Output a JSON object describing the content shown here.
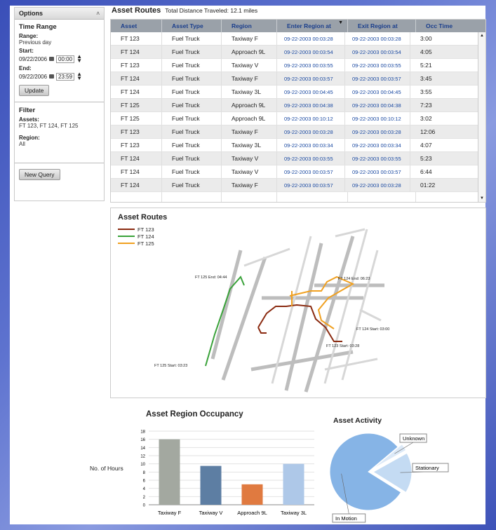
{
  "options": {
    "header": "Options",
    "collapse_icon": "double-chevron-up",
    "time_range_title": "Time Range",
    "range_label": "Range:",
    "range_value": "Previous day",
    "start_label": "Start:",
    "start_date": "09/22/2006",
    "start_time": "00:00",
    "end_label": "End:",
    "end_date": "09/22/2006",
    "end_time": "23:59",
    "update_button": "Update",
    "filter_title": "Filter",
    "assets_label": "Assets:",
    "assets_value": "FT 123, FT 124, FT 125",
    "region_label": "Region:",
    "region_value": "All",
    "new_query_button": "New Query"
  },
  "routes_table": {
    "title": "Asset Routes",
    "subtitle": "Total Distance Traveled: 12.1 miles",
    "columns": [
      "Asset",
      "Asset Type",
      "Region",
      "Enter Region at",
      "Exit Region at",
      "Occ Time"
    ],
    "sort_column": "Enter Region at",
    "rows": [
      [
        "FT 123",
        "Fuel Truck",
        "Taxiway F",
        "09-22-2003 00:03:28",
        "09-22-2003 00:03:28",
        "3:00"
      ],
      [
        "FT 124",
        "Fuel Truck",
        "Approach 9L",
        "09-22-2003 00:03:54",
        "09-22-2003 00:03:54",
        "4:05"
      ],
      [
        "FT 123",
        "Fuel Truck",
        "Taxiway V",
        "09-22-2003 00:03:55",
        "09-22-2003 00:03:55",
        "5:21"
      ],
      [
        "FT 124",
        "Fuel Truck",
        "Taxiway F",
        "09-22-2003 00:03:57",
        "09-22-2003 00:03:57",
        "3:45"
      ],
      [
        "FT 124",
        "Fuel Truck",
        "Taxiway 3L",
        "09-22-2003 00:04:45",
        "09-22-2003 00:04:45",
        "3:55"
      ],
      [
        "FT 125",
        "Fuel Truck",
        "Approach 9L",
        "09-22-2003 00:04:38",
        "09-22-2003 00:04:38",
        "7:23"
      ],
      [
        "FT 125",
        "Fuel Truck",
        "Approach 9L",
        "09-22-2003 00:10:12",
        "09-22-2003 00:10:12",
        "3:02"
      ],
      [
        "FT 123",
        "Fuel Truck",
        "Taxiway F",
        "09-22-2003 00:03:28",
        "09-22-2003 00:03:28",
        "12:06"
      ],
      [
        "FT 123",
        "Fuel Truck",
        "Taxiway 3L",
        "09-22-2003 00:03:34",
        "09-22-2003 00:03:34",
        "4:07"
      ],
      [
        "FT 124",
        "Fuel Truck",
        "Taxiway V",
        "09-22-2003 00:03:55",
        "09-22-2003 00:03:55",
        "5:23"
      ],
      [
        "FT 124",
        "Fuel Truck",
        "Taxiway V",
        "09-22-2003 00:03:57",
        "09-22-2003 00:03:57",
        "6:44"
      ],
      [
        "FT 124",
        "Fuel Truck",
        "Taxiway F",
        "09-22-2003 00:03:57",
        "09-22-2003 00:03:28",
        "01:22"
      ]
    ]
  },
  "map": {
    "title": "Asset Routes",
    "legend": [
      {
        "name": "FT 123",
        "color": "#8a2a10"
      },
      {
        "name": "FT 124",
        "color": "#3aa23a"
      },
      {
        "name": "FT 125",
        "color": "#f0a020"
      }
    ],
    "annotations": [
      "FT 125 End: 04:44",
      "FT 124 End: 06:23",
      "FT 124 Start: 03:00",
      "FT 123 Start: 03:28",
      "FT 125 Start: 03:23"
    ]
  },
  "chart_data": [
    {
      "type": "bar",
      "title": "Asset Region Occupancy",
      "ylabel": "No. of Hours",
      "xlabel": "",
      "categories": [
        "Taxiway F",
        "Taxiway V",
        "Approach 9L",
        "Taxiway 3L"
      ],
      "values": [
        16,
        9.5,
        5,
        10
      ],
      "colors": [
        "#a3a8a0",
        "#5d7ea3",
        "#e07a40",
        "#aec8e8"
      ],
      "ylim": [
        0,
        18
      ],
      "yticks": [
        0,
        2,
        4,
        6,
        8,
        10,
        12,
        14,
        16,
        18
      ],
      "grid": true
    },
    {
      "type": "pie",
      "title": "Asset Activity",
      "labels": [
        "In Motion",
        "Unknown",
        "Stationary"
      ],
      "values": [
        80,
        3,
        17
      ],
      "colors": [
        "#86b4e6",
        "#dce9f7",
        "#c4dbf3"
      ]
    }
  ]
}
